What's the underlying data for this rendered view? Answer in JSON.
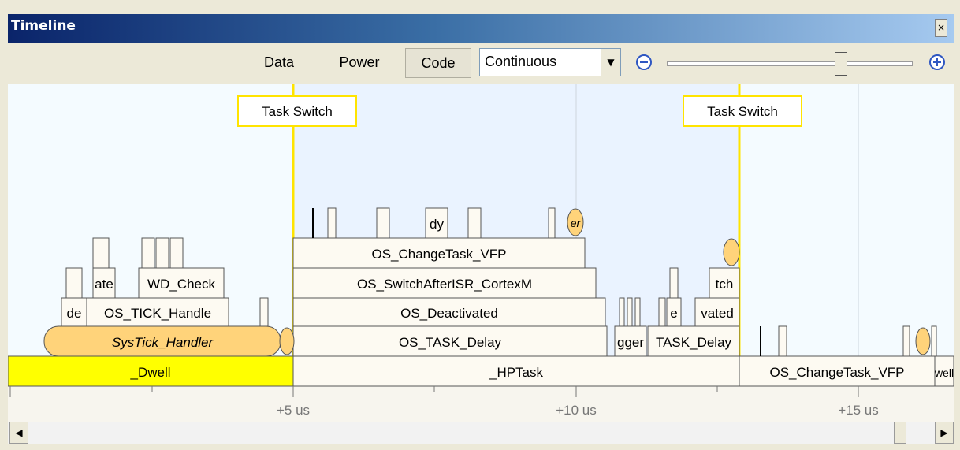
{
  "window": {
    "title": "Timeline",
    "close_glyph": "×"
  },
  "toolbar": {
    "data_label": "Data",
    "power_label": "Power",
    "code_label": "Code",
    "mode_select": {
      "selected": "Continuous"
    },
    "zoom_out_icon": "zoom-out-icon",
    "zoom_in_icon": "zoom-in-icon",
    "zoom_level": 0.72
  },
  "timeline": {
    "task_switch_label": "Task Switch",
    "ticks": [
      "+5 us",
      "+10 us",
      "+15 us"
    ],
    "task_lane": [
      "_Dwell",
      "_HPTask",
      "OS_ChangeTask_VFP",
      "well"
    ],
    "stack_center": [
      "OS_TASK_Delay",
      "OS_Deactivated",
      "OS_SwitchAfterISR_CortexM",
      "OS_ChangeTask_VFP"
    ],
    "stack_left": [
      "SysTick_Handler",
      "de",
      "OS_TICK_Handle",
      "ate",
      "WD_Check"
    ],
    "stack_right": [
      "gger",
      "TASK_Delay",
      "e",
      "vated",
      "tch"
    ],
    "small_labels": [
      "dy",
      "er"
    ]
  },
  "colors": {
    "dwell": "#ffff00",
    "handler": "#ffd37a",
    "block": "#fdfaf2",
    "title_left": "#0a246a",
    "title_right": "#a6caf0"
  }
}
